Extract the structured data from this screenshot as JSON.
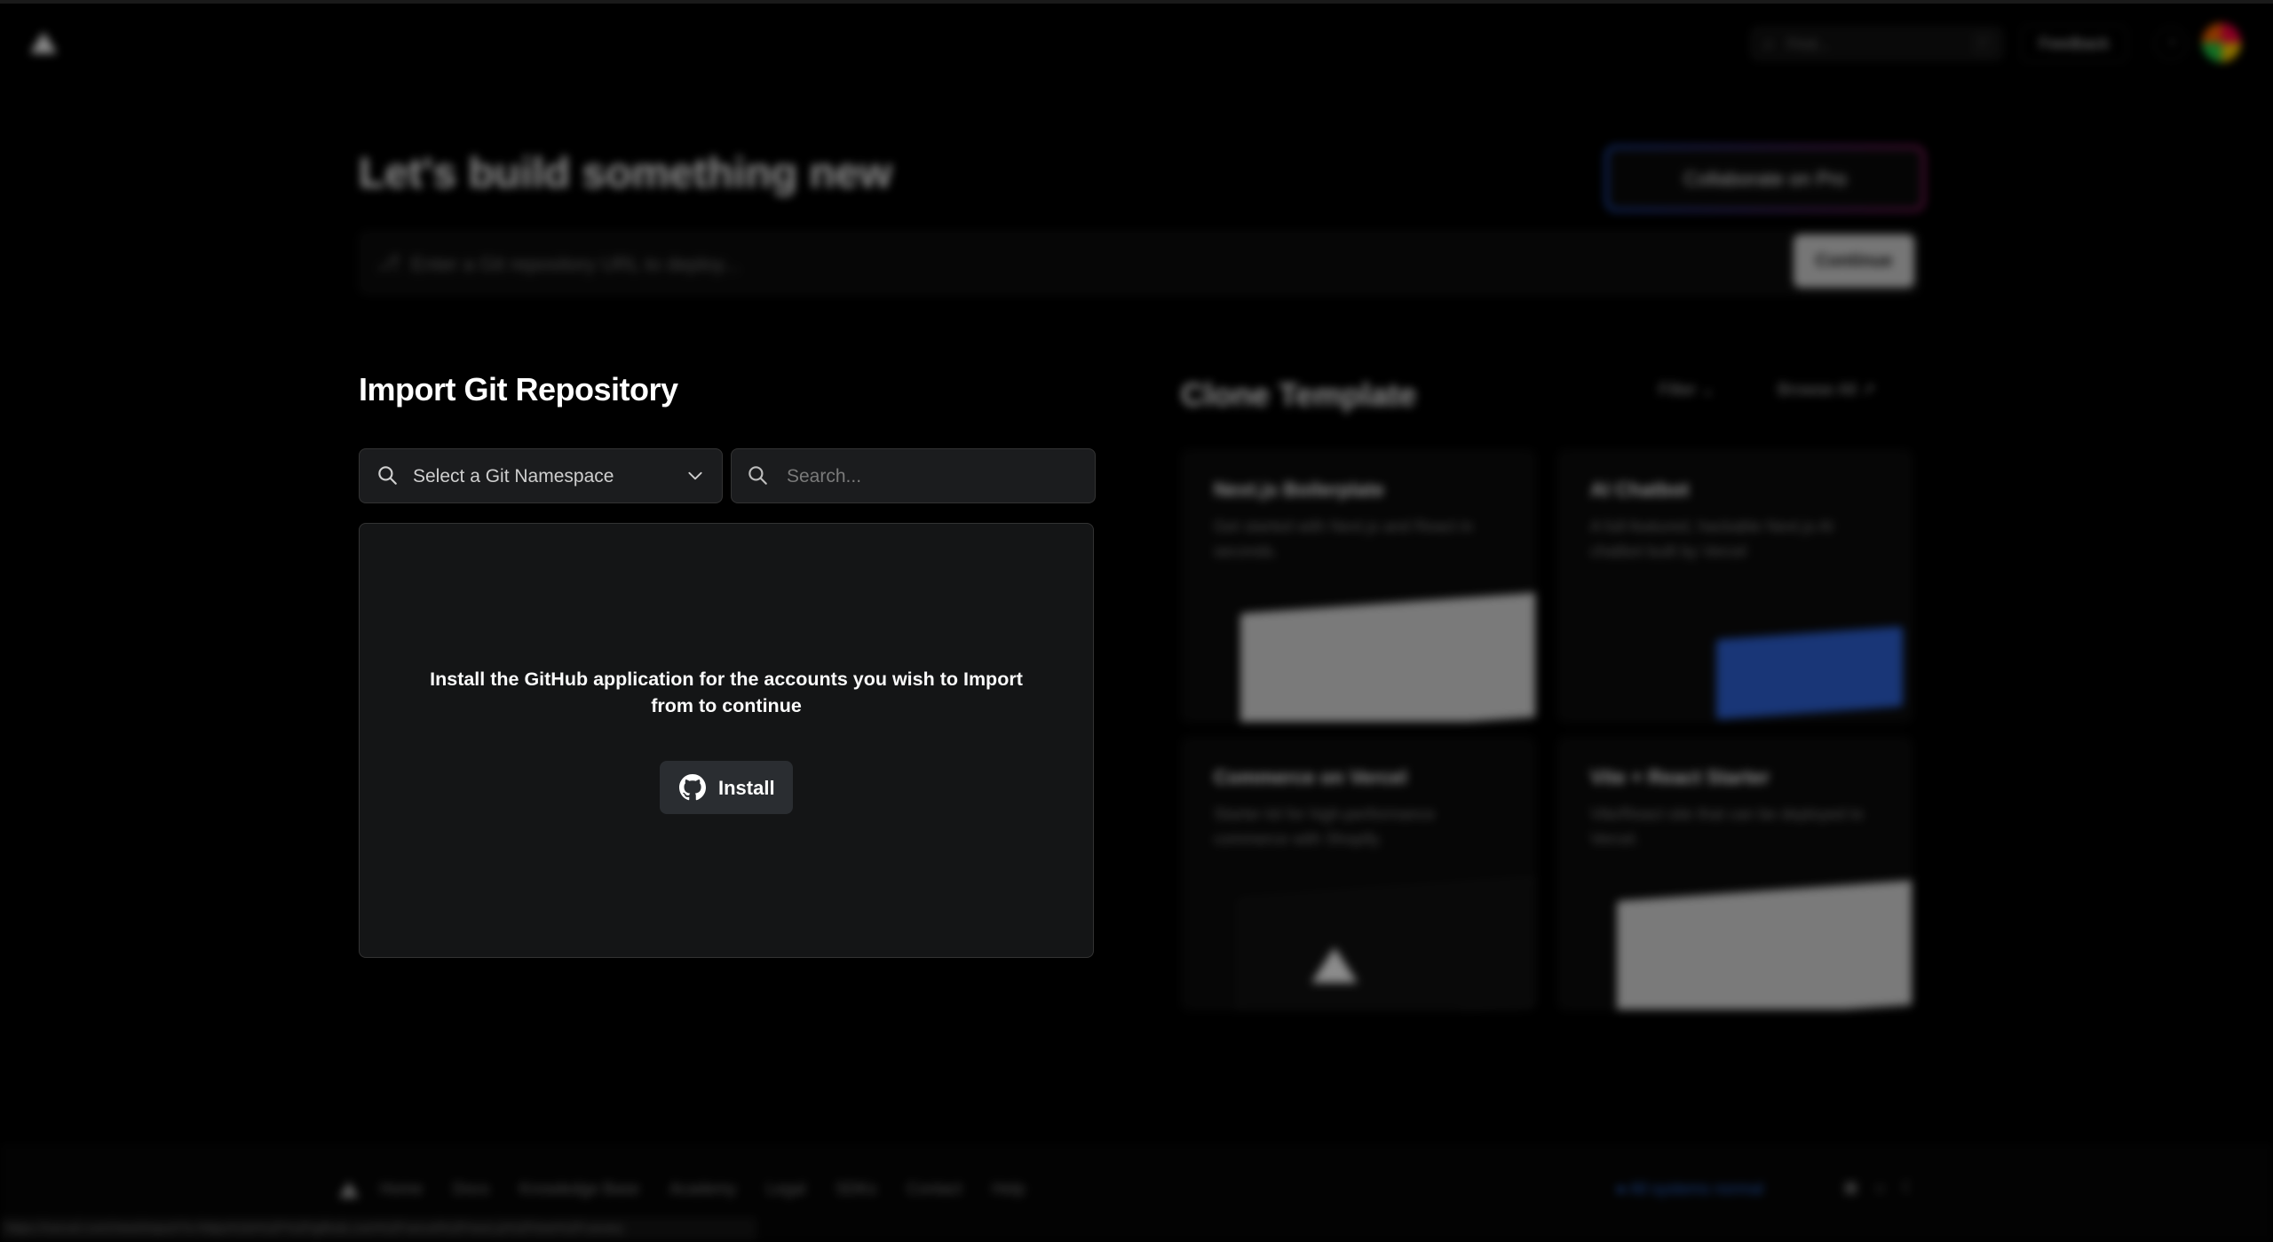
{
  "nav": {
    "search_placeholder": "Find...",
    "search_shortcut": "F",
    "feedback_label": "Feedback"
  },
  "hero": {
    "title": "Let's build something new",
    "collab_label": "Collaborate on Pro",
    "url_placeholder": "Enter a Git repository URL to deploy...",
    "continue_label": "Continue"
  },
  "import": {
    "title": "Import Git Repository",
    "namespace_placeholder": "Select a Git Namespace",
    "search_placeholder": "Search...",
    "empty_message": "Install the GitHub application for the accounts you wish to Import from to continue",
    "install_label": "Install"
  },
  "clone": {
    "title": "Clone Template",
    "filter_label": "Filter",
    "browse_label": "Browse All",
    "templates": [
      {
        "title": "Next.js Boilerplate",
        "description": "Get started with Next.js and React in seconds."
      },
      {
        "title": "AI Chatbot",
        "description": "A full-featured, hackable Next.js AI chatbot built by Vercel"
      },
      {
        "title": "Commerce on Vercel",
        "description": "Starter kit for high-performance commerce with Shopify."
      },
      {
        "title": "Vite + React Starter",
        "description": "Vite/React site that can be deployed to Vercel."
      }
    ]
  },
  "footer": {
    "links": [
      "Home",
      "Docs",
      "Knowledge Base",
      "Academy",
      "Legal",
      "SDKs",
      "Contact",
      "Help"
    ],
    "status": "All systems normal",
    "status_url": "https://vercel.com/new/import?s=https%3A%2F%2Fgithub.com%2Fvercel%2Fnext.js%2Ftree%2Fcanary"
  },
  "colors": {
    "background": "#000000",
    "panel": "#141516",
    "input": "#1b1c1e",
    "button": "#2a2d31",
    "status": "#2f6fe0"
  }
}
